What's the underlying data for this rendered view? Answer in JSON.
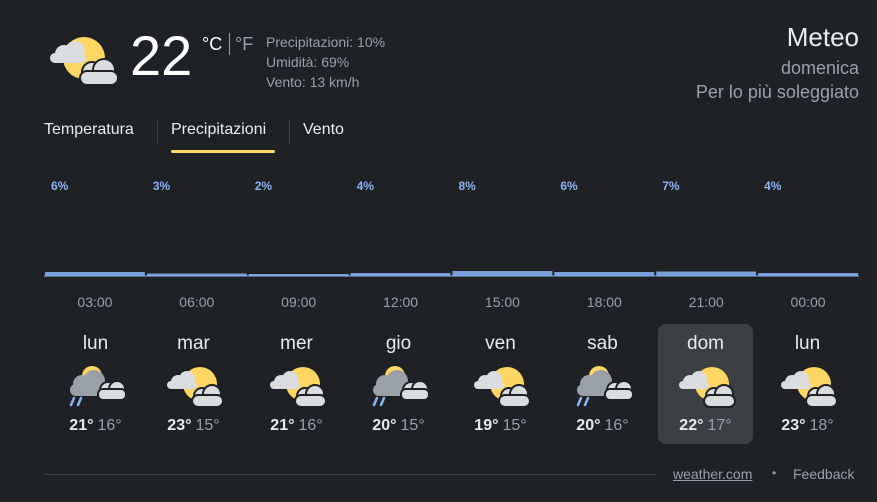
{
  "current": {
    "temp": "22",
    "unit_c": "°C",
    "unit_f": "°F",
    "precip": "Precipitazioni: 10%",
    "humidity": "Umidità: 69%",
    "wind": "Vento: 13 km/h",
    "icon": "partly-sunny-icon"
  },
  "header": {
    "title": "Meteo",
    "day": "domenica",
    "condition": "Per lo più soleggiato"
  },
  "tabs": [
    {
      "label": "Temperatura"
    },
    {
      "label": "Precipitazioni",
      "selected": true
    },
    {
      "label": "Vento"
    }
  ],
  "colors": {
    "accent": "#fdd663",
    "series": "#8ab4f8",
    "background": "#202124",
    "selected_day_bg": "#3c4043"
  },
  "chart_data": {
    "type": "bar",
    "categories": [
      "03:00",
      "06:00",
      "09:00",
      "12:00",
      "15:00",
      "18:00",
      "21:00",
      "00:00"
    ],
    "x_tick_labels": [
      "03:00",
      "06:00",
      "09:00",
      "12:00",
      "15:00",
      "18:00",
      "21:00",
      "00:00"
    ],
    "values": [
      6,
      3,
      2,
      4,
      8,
      6,
      7,
      4
    ],
    "value_labels": [
      "6%",
      "3%",
      "2%",
      "4%",
      "8%",
      "6%",
      "7%",
      "4%"
    ],
    "unit": "%",
    "ylim": [
      0,
      100
    ],
    "grid": false
  },
  "days": [
    {
      "name": "lun",
      "max": "21°",
      "min": "16°",
      "icon": "rain-cloud-icon"
    },
    {
      "name": "mar",
      "max": "23°",
      "min": "15°",
      "icon": "partly-sunny-icon"
    },
    {
      "name": "mer",
      "max": "21°",
      "min": "16°",
      "icon": "partly-sunny-icon"
    },
    {
      "name": "gio",
      "max": "20°",
      "min": "15°",
      "icon": "rain-cloud-icon"
    },
    {
      "name": "ven",
      "max": "19°",
      "min": "15°",
      "icon": "partly-sunny-icon"
    },
    {
      "name": "sab",
      "max": "20°",
      "min": "16°",
      "icon": "rain-cloud-icon"
    },
    {
      "name": "dom",
      "max": "22°",
      "min": "17°",
      "icon": "partly-sunny-icon",
      "selected": true
    },
    {
      "name": "lun",
      "max": "23°",
      "min": "18°",
      "icon": "partly-sunny-icon"
    }
  ],
  "footer": {
    "source": "weather.com",
    "separator": "•",
    "feedback": "Feedback"
  }
}
